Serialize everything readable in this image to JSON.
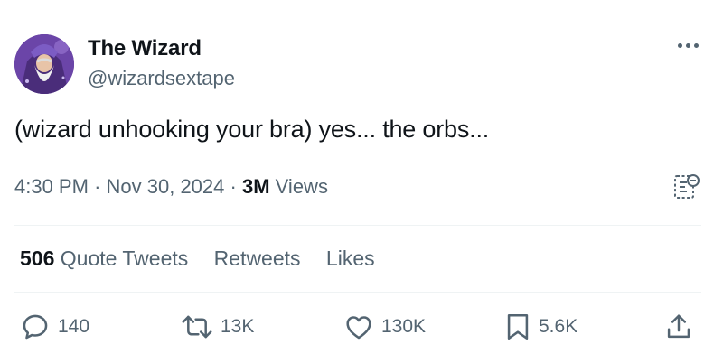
{
  "author": {
    "display_name": "The Wizard",
    "handle": "@wizardsextape"
  },
  "tweet": {
    "text": "(wizard unhooking your bra) yes... the orbs..."
  },
  "meta": {
    "time": "4:30 PM",
    "separator": "·",
    "date": "Nov 30, 2024",
    "views_count": "3M",
    "views_label": "Views"
  },
  "stats": {
    "quote_count": "506",
    "quote_label": "Quote Tweets",
    "retweets_label": "Retweets",
    "likes_label": "Likes"
  },
  "actions": {
    "replies": "140",
    "retweets": "13K",
    "likes": "130K",
    "bookmarks": "5.6K"
  },
  "icons": [
    "avatar",
    "more-icon",
    "analytics-icon",
    "reply-icon",
    "retweet-icon",
    "like-icon",
    "bookmark-icon",
    "share-icon"
  ],
  "colors": {
    "text": "#0f1419",
    "secondary": "#536471",
    "divider": "#eff3f4"
  }
}
